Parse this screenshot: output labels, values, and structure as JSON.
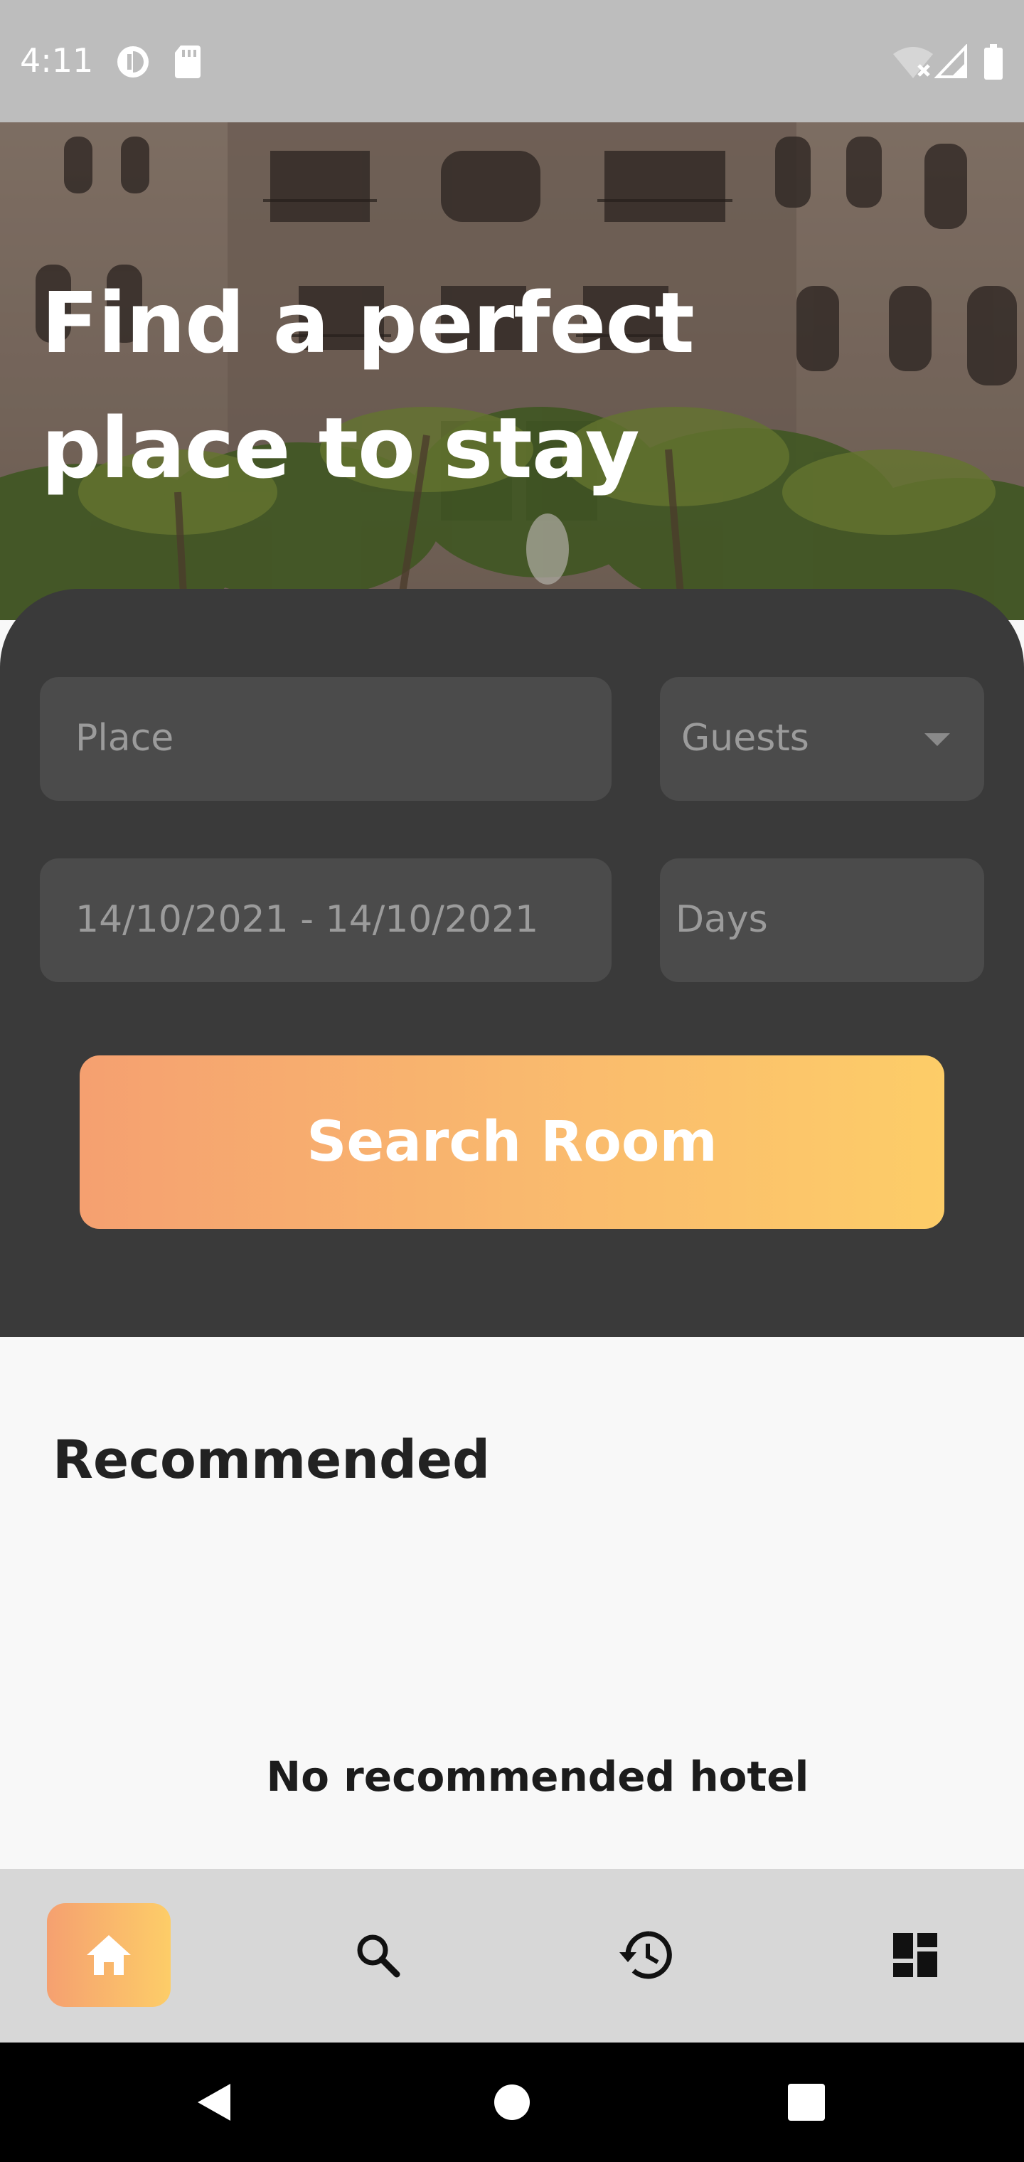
{
  "status_bar": {
    "time": "4:11",
    "icons": [
      "data-saver-icon",
      "sd-card-icon",
      "wifi-off-icon",
      "signal-icon",
      "battery-icon"
    ]
  },
  "hero": {
    "title": "Find a perfect place to stay",
    "image": "hotel-courtyard-palms"
  },
  "search_form": {
    "place_placeholder": "Place",
    "guests_placeholder": "Guests",
    "date_range": "14/10/2021 - 14/10/2021",
    "days_placeholder": "Days",
    "submit_label": "Search Room"
  },
  "recommended": {
    "title": "Recommended",
    "empty_message": "No recommended hotel"
  },
  "bottom_nav": {
    "items": [
      {
        "icon": "home-icon",
        "active": true
      },
      {
        "icon": "search-icon",
        "active": false
      },
      {
        "icon": "history-icon",
        "active": false
      },
      {
        "icon": "dashboard-icon",
        "active": false
      }
    ]
  },
  "system_nav": [
    "back-icon",
    "home-circle-icon",
    "recents-icon"
  ],
  "colors": {
    "accent_start": "#f5a070",
    "accent_end": "#fdcd68",
    "panel": "#3a3a3a",
    "field": "#4b4b4b"
  }
}
